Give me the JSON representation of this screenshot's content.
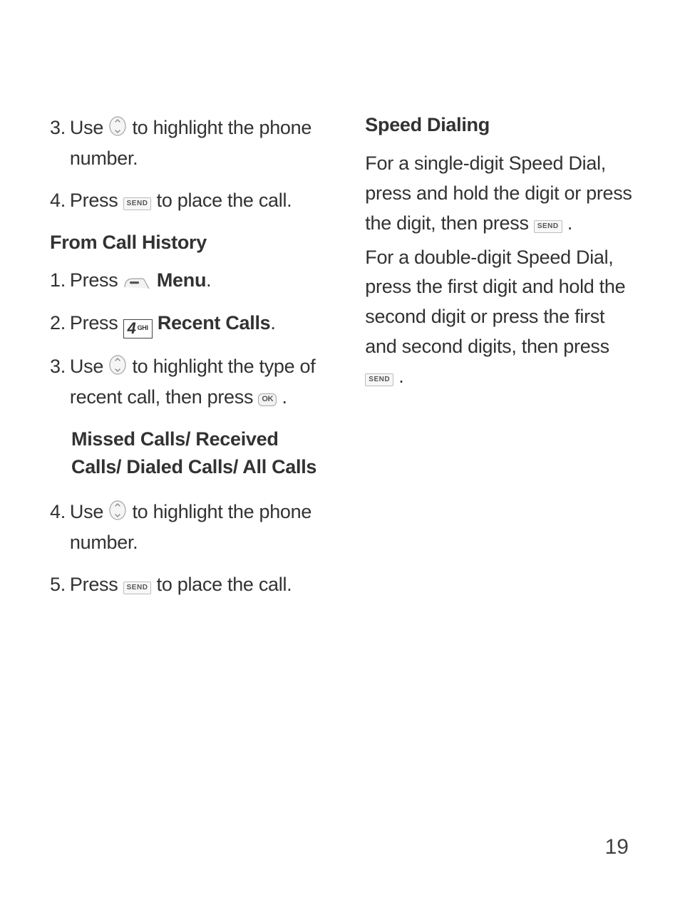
{
  "left": {
    "step3a": {
      "num": "3.",
      "t1": "Use ",
      "t2": " to highlight the phone number."
    },
    "step4a": {
      "num": "4.",
      "t1": "Press ",
      "t2": " to place the call."
    },
    "heading1": "From Call History",
    "step1": {
      "num": "1.",
      "t1": "Press ",
      "menu": "Menu",
      "t2": "."
    },
    "step2": {
      "num": "2.",
      "t1": "Press ",
      "recent": "Recent Calls",
      "t2": "."
    },
    "step3b": {
      "num": "3.",
      "t1": "Use ",
      "t2": " to highlight the type of recent call, then press ",
      "t3": "."
    },
    "options": "Missed Calls/ Received Calls/ Dialed Calls/ All Calls",
    "step4b": {
      "num": "4.",
      "t1": "Use ",
      "t2": " to highlight the phone number."
    },
    "step5": {
      "num": "5.",
      "t1": "Press ",
      "t2": " to place the call."
    }
  },
  "right": {
    "heading": "Speed Dialing",
    "p1a": "For a single-digit Speed Dial, press and hold the digit or press the digit, then press ",
    "p1b": ".",
    "p2a": "For a double-digit Speed Dial, press the first digit and hold the second digit or press the first and second digits, then press ",
    "p2b": "."
  },
  "keys": {
    "send": "SEND",
    "ok": "OK",
    "four": "4",
    "ghi": "GHI"
  },
  "pageNumber": "19"
}
